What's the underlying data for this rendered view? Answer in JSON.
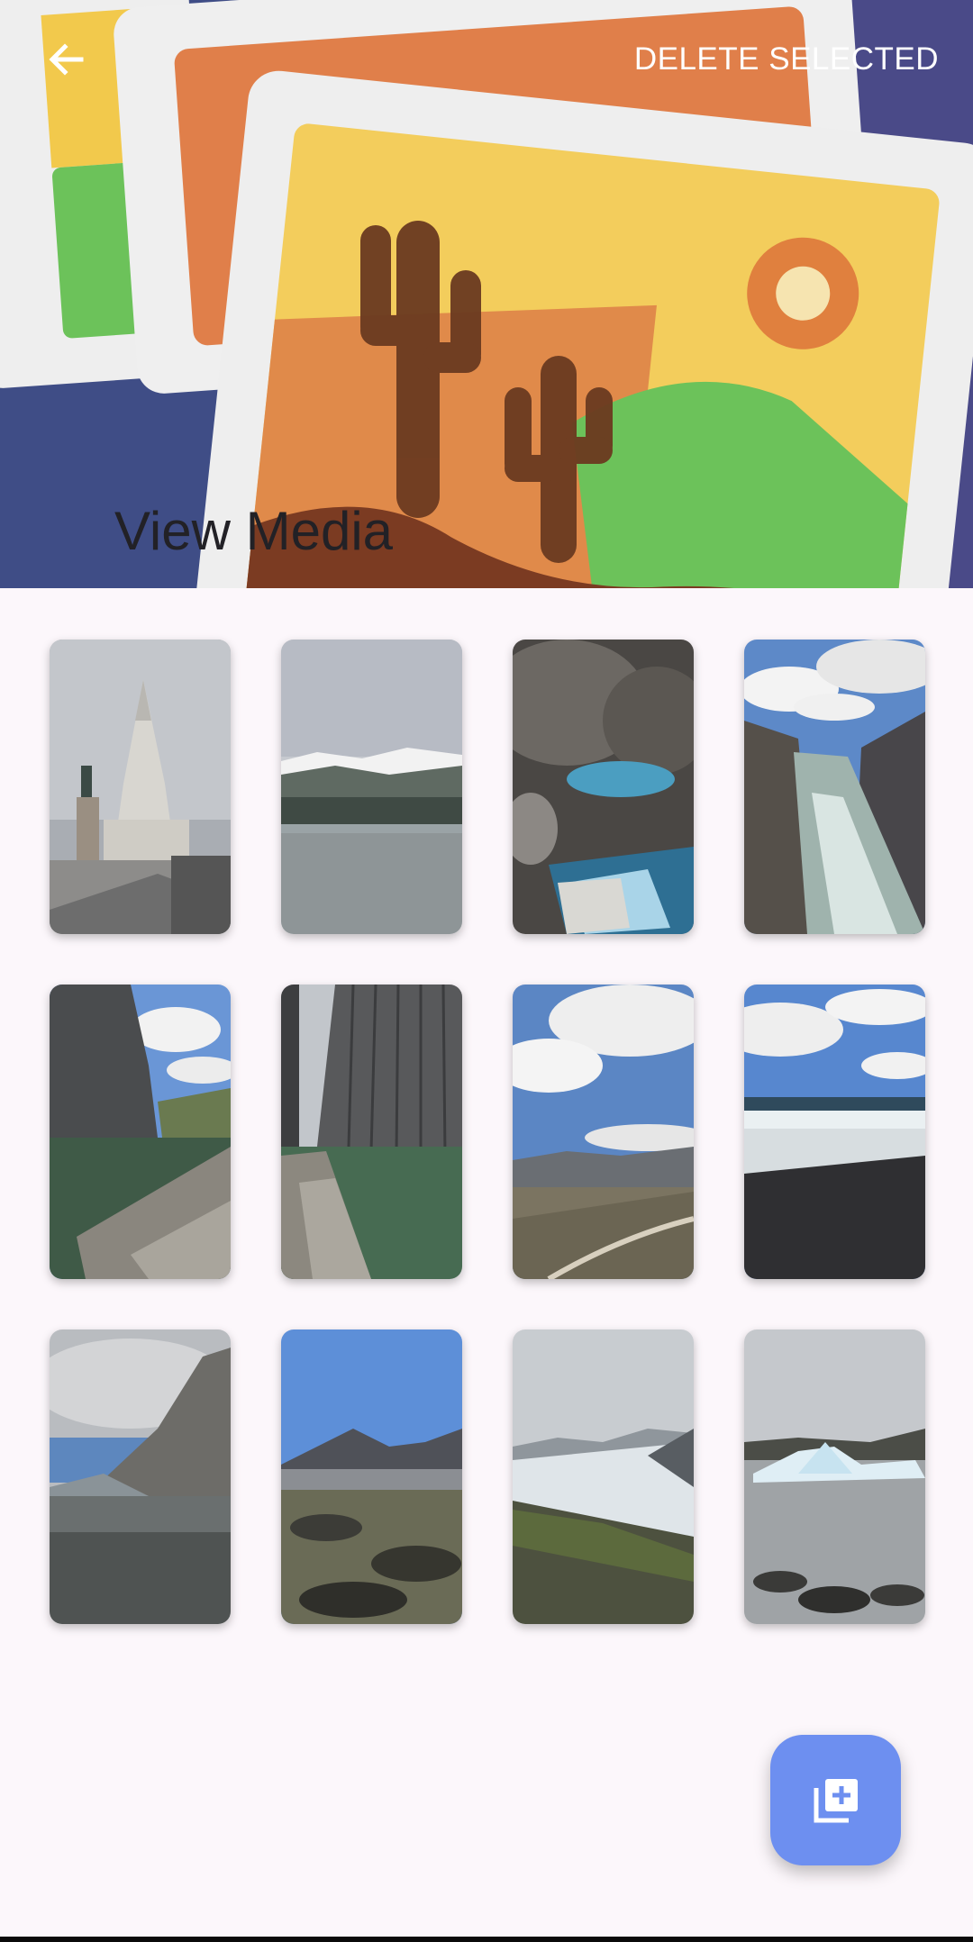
{
  "header": {
    "title": "View Media",
    "delete_label": "DELETE SELECTED",
    "back_icon": "arrow-left-icon",
    "colors": {
      "background": "#3f4d86",
      "toolbar_text": "#ffffff",
      "title_text": "#222126"
    }
  },
  "gallery": {
    "items": [
      {
        "subject": "church-tower-statue"
      },
      {
        "subject": "snowy-mountain-town"
      },
      {
        "subject": "lava-cave-pool"
      },
      {
        "subject": "river-canyon"
      },
      {
        "subject": "basalt-canyon-river"
      },
      {
        "subject": "basalt-columns-river"
      },
      {
        "subject": "valley-clouds"
      },
      {
        "subject": "black-sand-beach"
      },
      {
        "subject": "mountain-lake"
      },
      {
        "subject": "lava-field-mountains"
      },
      {
        "subject": "glacier-tongue"
      },
      {
        "subject": "iceberg-lagoon"
      }
    ]
  },
  "fab": {
    "icon": "add-to-library-icon",
    "color": "#6d8ff0"
  }
}
